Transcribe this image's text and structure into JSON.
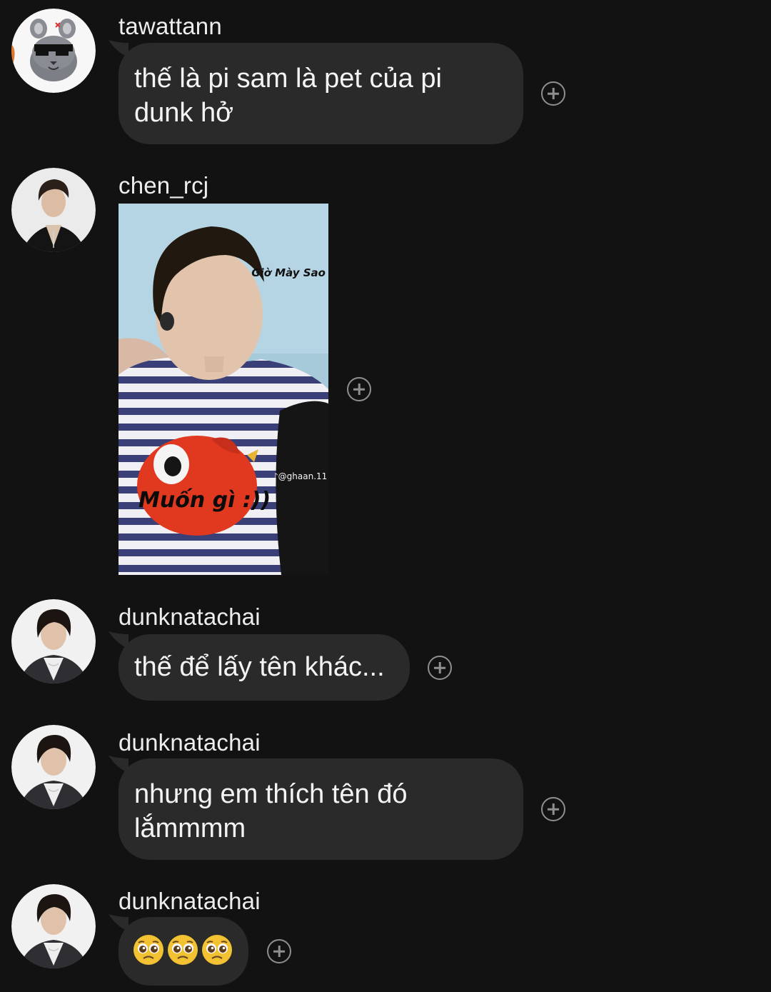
{
  "messages": [
    {
      "username": "tawattann",
      "text_lines": [
        "thế là pi sam là pet của pi",
        "dunk hở"
      ],
      "avatar": "chinchilla-sunglasses-avatar"
    },
    {
      "username": "chen_rcj",
      "avatar": "man-black-jacket-avatar",
      "image": {
        "caption_top": "Giờ Mày Sao",
        "caption_bottom": "Muốn gì :))",
        "watermark": "@ghaan.11"
      }
    },
    {
      "username": "dunknatachai",
      "text_lines": [
        "thế để lấy tên khác..."
      ],
      "avatar": "dunk-avatar"
    },
    {
      "username": "dunknatachai",
      "text_lines": [
        "nhưng em thích tên đó",
        "lắmmmm"
      ],
      "avatar": "dunk-avatar"
    },
    {
      "username": "dunknatachai",
      "emoji": [
        "pleading-face",
        "pleading-face",
        "pleading-face"
      ],
      "avatar": "dunk-avatar"
    }
  ],
  "colors": {
    "background": "#121212",
    "bubble": "#2a2a2a",
    "text": "#f4f4f4",
    "react_icon": "#8f8f8f"
  },
  "icons": {
    "reaction": "add-reaction-icon"
  }
}
